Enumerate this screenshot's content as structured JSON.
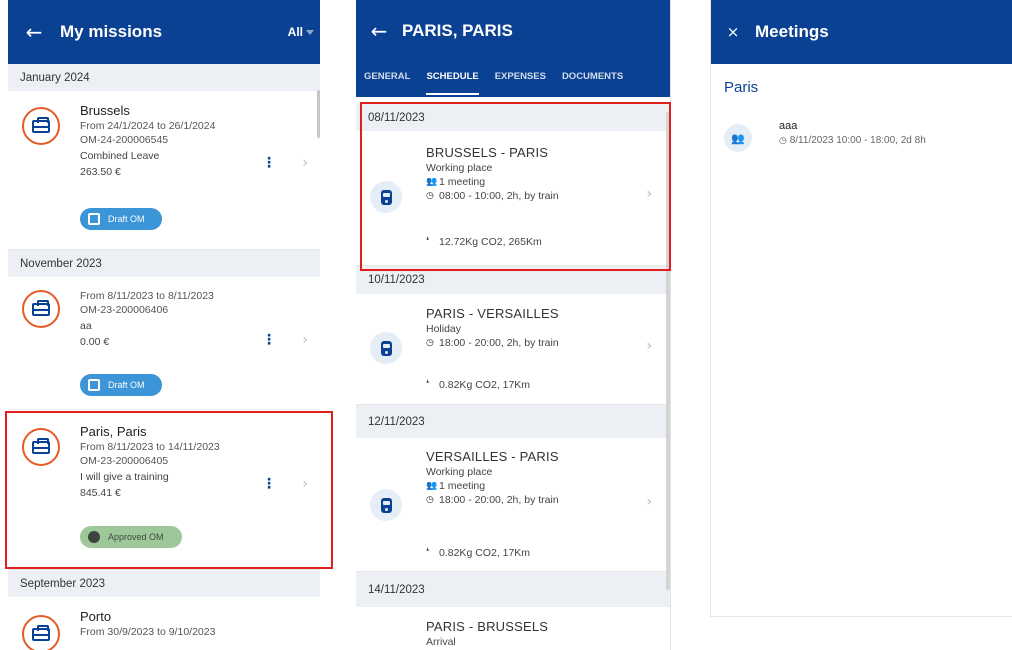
{
  "missions_panel": {
    "title": "My missions",
    "filter": "All",
    "groups": [
      {
        "label": "January 2024",
        "missions": [
          {
            "title": "Brussels",
            "dates": "From 24/1/2024 to 26/1/2024",
            "code": "OM-24-200006545",
            "description": "Combined Leave",
            "amount": "263.50 €",
            "status": "Draft OM"
          }
        ]
      },
      {
        "label": "November 2023",
        "missions": [
          {
            "title": "",
            "dates": "From 8/11/2023 to 8/11/2023",
            "code": "OM-23-200006406",
            "description": "aa",
            "amount": "0.00 €",
            "status": "Draft OM"
          },
          {
            "title": "Paris, Paris",
            "dates": "From 8/11/2023 to 14/11/2023",
            "code": "OM-23-200006405",
            "description": "I will give a training",
            "amount": "845.41 €",
            "status": "Approved OM"
          }
        ]
      },
      {
        "label": "September 2023",
        "missions": [
          {
            "title": "Porto",
            "dates": "From 30/9/2023 to 9/10/2023",
            "code": "",
            "description": "",
            "amount": "",
            "status": ""
          }
        ]
      }
    ]
  },
  "schedule_panel": {
    "title": "PARIS, PARIS",
    "tabs": [
      "GENERAL",
      "SCHEDULE",
      "EXPENSES",
      "DOCUMENTS"
    ],
    "active_tab": "SCHEDULE",
    "days": [
      {
        "date": "08/11/2023",
        "trip": {
          "route": "BRUSSELS - PARIS",
          "type": "Working place",
          "meetings": "1 meeting",
          "time": "08:00 - 10:00, 2h, by train",
          "co2": "12.72Kg CO2, 265Km"
        }
      },
      {
        "date": "10/11/2023",
        "trip": {
          "route": "PARIS - VERSAILLES",
          "type": "Holiday",
          "meetings": "",
          "time": "18:00 - 20:00, 2h, by train",
          "co2": "0.82Kg CO2, 17Km"
        }
      },
      {
        "date": "12/11/2023",
        "trip": {
          "route": "VERSAILLES - PARIS",
          "type": "Working place",
          "meetings": "1 meeting",
          "time": "18:00 - 20:00, 2h, by train",
          "co2": "0.82Kg CO2, 17Km"
        }
      },
      {
        "date": "14/11/2023",
        "trip": {
          "route": "PARIS - BRUSSELS",
          "type": "Arrival",
          "meetings": "",
          "time": "",
          "co2": ""
        }
      }
    ]
  },
  "meetings_panel": {
    "title": "Meetings",
    "city": "Paris",
    "meetings": [
      {
        "name": "aaa",
        "time": "8/11/2023 10:00 - 18:00, 2d 8h"
      }
    ]
  },
  "colors": {
    "brand_blue": "#0a4192",
    "accent_orange": "#e65a28",
    "highlight_red": "#e01e1e",
    "draft_badge": "#3b95d6",
    "approved_badge": "#9ec79a"
  },
  "icons": {
    "back": "arrow-left-icon",
    "close": "close-icon",
    "mission": "briefcase-icon",
    "trip": "train-icon",
    "meeting": "people-icon",
    "time": "clock-icon",
    "co2": "footprint-icon",
    "more": "kebab-menu-icon",
    "open": "chevron-right-icon"
  }
}
